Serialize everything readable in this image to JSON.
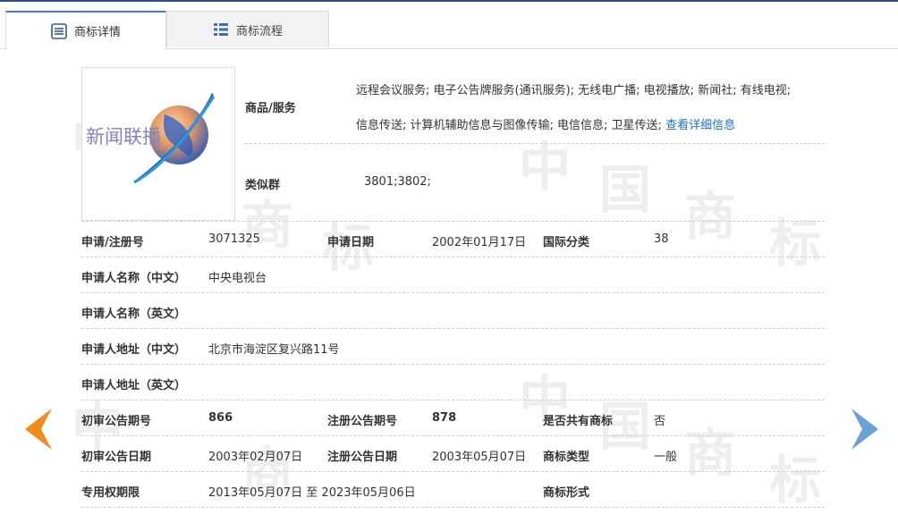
{
  "tabs": [
    {
      "label": "商标详情",
      "active": true
    },
    {
      "label": "商标流程",
      "active": false
    }
  ],
  "logo": {
    "text": "新闻联播"
  },
  "goods": {
    "label": "商品/服务",
    "line1": "远程会议服务; 电子公告牌服务(通讯服务); 无线电广播; 电视播放; 新闻社; 有线电视;",
    "line2": "信息传送; 计算机辅助信息与图像传输; 电信信息; 卫星传送;",
    "more_link": "查看详细信息"
  },
  "similar": {
    "label": "类似群",
    "value": "3801;3802;"
  },
  "rows": {
    "reg_no_label": "申请/注册号",
    "reg_no": "3071325",
    "apply_date_label": "申请日期",
    "apply_date": "2002年01月17日",
    "intl_class_label": "国际分类",
    "intl_class": "38",
    "applicant_cn_label": "申请人名称（中文）",
    "applicant_cn": "中央电视台",
    "applicant_en_label": "申请人名称（英文）",
    "applicant_en": "",
    "address_cn_label": "申请人地址（中文）",
    "address_cn": "北京市海淀区复兴路11号",
    "address_en_label": "申请人地址（英文）",
    "address_en": "",
    "prelim_no_label": "初审公告期号",
    "prelim_no": "866",
    "reg_notice_no_label": "注册公告期号",
    "reg_notice_no": "878",
    "shared_label": "是否共有商标",
    "shared": "否",
    "prelim_date_label": "初审公告日期",
    "prelim_date": "2003年02月07日",
    "reg_notice_date_label": "注册公告日期",
    "reg_notice_date": "2003年05月07日",
    "tm_type_label": "商标类型",
    "tm_type": "一般",
    "exclusive_label": "专用权期限",
    "exclusive": "2013年05月07日 至 2023年05月06日",
    "tm_form_label": "商标形式",
    "tm_form": ""
  },
  "watermark_chars": [
    "中",
    "国",
    "商",
    "标"
  ],
  "colors": {
    "accent": "#4a7cc9",
    "link": "#1a73c7",
    "prev_arrow": "#f28c1e",
    "next_arrow": "#6aa0d8"
  }
}
